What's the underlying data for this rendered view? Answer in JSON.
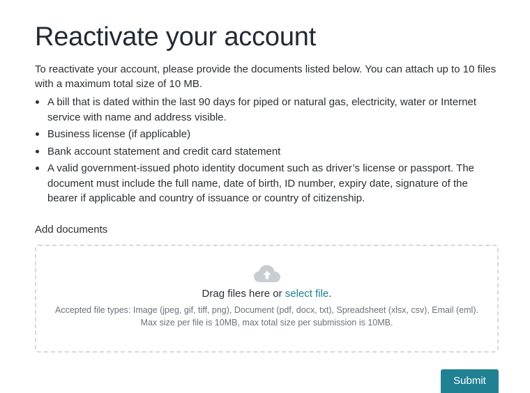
{
  "page": {
    "title": "Reactivate your account",
    "intro": "To reactivate your account, please provide the documents listed below. You can attach up to 10 files with a maximum total size of 10 MB."
  },
  "requirements": [
    "A bill that is dated within the last 90 days for piped or natural gas, electricity, water or Internet service with name and address visible.",
    "Business license (if applicable)",
    "Bank account statement and credit card statement",
    "A valid government-issued photo identity document such as driver’s license or passport. The document must include the full name, date of birth, ID number, expiry date, signature of the bearer if applicable and country of issuance or country of citizenship."
  ],
  "upload": {
    "label": "Add documents",
    "icon": "cloud-upload-icon",
    "drag_text": "Drag files here or ",
    "link_text": "select file",
    "drag_suffix": ".",
    "accepted_types": "Accepted file types: Image (jpeg, gif, tiff, png), Document (pdf, docx, txt), Spreadsheet (xlsx, csv), Email (eml). Max size per file is 10MB, max total size per submission is 10MB."
  },
  "actions": {
    "submit_label": "Submit"
  },
  "colors": {
    "accent": "#1f8192",
    "link": "#1a7f8e",
    "dropzone_border": "#d5d9de",
    "icon_gray": "#c9cdd2"
  }
}
